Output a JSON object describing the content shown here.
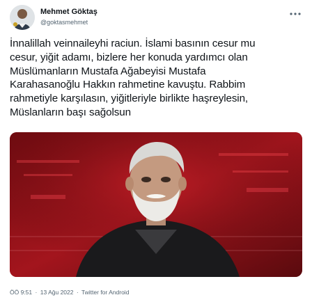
{
  "tweet": {
    "author": {
      "display_name": "Mehmet Göktaş",
      "handle": "@goktasmehmet",
      "avatar_icon": "user-avatar"
    },
    "text": "İnnalillah veinnaileyhi raciun. İslami basının cesur mu\ncesur, yiğit adamı, bizlere her konuda yardımcı olan\nMüslümanların Mustafa Ağabeyisi Mustafa\nKarahasanoğlu Hakkın rahmetine kavuştu. Rabbim\nrahmetiyle karşılasın, yiğitleriyle birlikte haşreylesin,\nMüslanların başı sağolsun",
    "media": {
      "type": "photo",
      "icon": "person-photo"
    },
    "time": "ÖÖ 9:51",
    "separator": "·",
    "date": "13 Ağu 2022",
    "source": "Twitter for Android",
    "more_icon": "more-dots-icon"
  },
  "colors": {
    "text": "#0f1419",
    "secondary_text": "#536471",
    "media_background": "#8d1016"
  }
}
